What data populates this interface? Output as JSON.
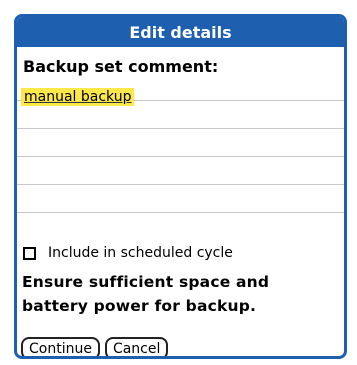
{
  "dialog": {
    "title": "Edit details",
    "comment_label": "Backup set comment:",
    "comment_value": "manual backup",
    "checkbox": {
      "label": "Include in scheduled cycle",
      "checked": false
    },
    "message_line1": "Ensure sufficient space and",
    "message_line2": "battery power for backup.",
    "buttons": {
      "continue_label": "Continue",
      "cancel_label": "Cancel"
    }
  },
  "colors": {
    "title_bar": "#1f5fb0",
    "highlight": "#ffe84a"
  }
}
